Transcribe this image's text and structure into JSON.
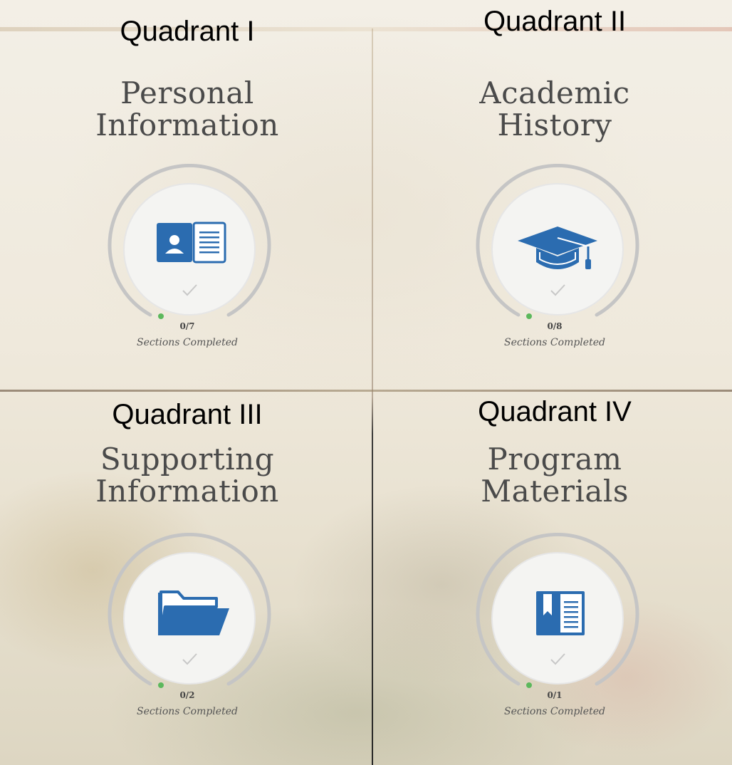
{
  "quadrants": [
    {
      "label": "Quadrant I",
      "title_line1": "Personal",
      "title_line2": "Information",
      "icon": "id-card-icon",
      "progress": "0/7",
      "completed": 0,
      "total": 7,
      "caption": "Sections Completed"
    },
    {
      "label": "Quadrant II",
      "title_line1": "Academic",
      "title_line2": "History",
      "icon": "graduation-cap-icon",
      "progress": "0/8",
      "completed": 0,
      "total": 8,
      "caption": "Sections Completed"
    },
    {
      "label": "Quadrant III",
      "title_line1": "Supporting",
      "title_line2": "Information",
      "icon": "folder-icon",
      "progress": "0/2",
      "completed": 0,
      "total": 2,
      "caption": "Sections Completed"
    },
    {
      "label": "Quadrant IV",
      "title_line1": "Program",
      "title_line2": "Materials",
      "icon": "book-icon",
      "progress": "0/1",
      "completed": 0,
      "total": 1,
      "caption": "Sections Completed"
    }
  ],
  "colors": {
    "icon_blue": "#2b6cb0",
    "ring_gray": "#c8c8c8",
    "progress_dot": "#5cb85c"
  }
}
